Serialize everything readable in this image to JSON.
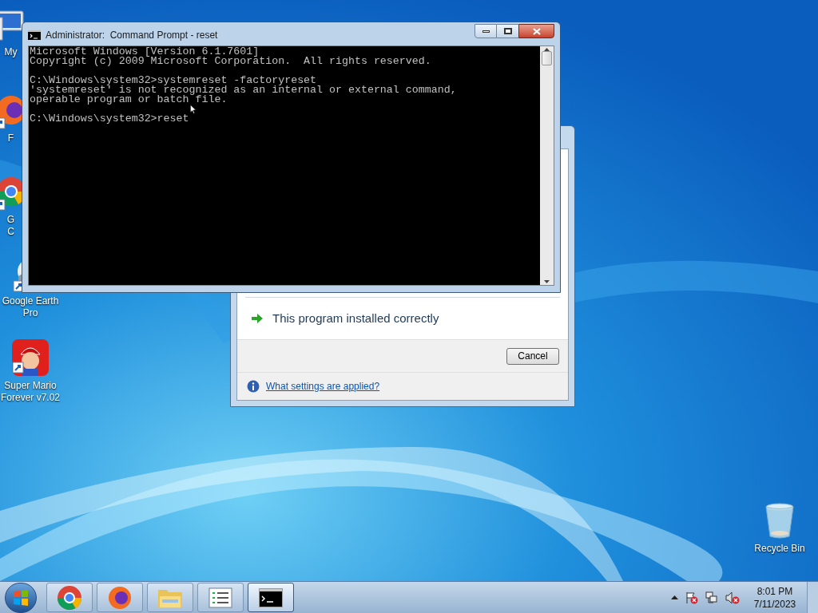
{
  "desktop_icons": [
    {
      "kind": "computer",
      "lines": [
        "My"
      ]
    },
    {
      "kind": "fox",
      "lines": [
        "F"
      ]
    },
    {
      "kind": "wheel",
      "lines": [
        "G",
        "C"
      ]
    },
    {
      "kind": "earth",
      "lines": [
        "Google Earth",
        "Pro"
      ]
    },
    {
      "kind": "game",
      "lines": [
        "Super Mario",
        "Forever v7.02"
      ]
    },
    {
      "kind": "bin",
      "lines": [
        "Recycle Bin"
      ]
    }
  ],
  "console_window": {
    "title": "Administrator:  Command Prompt - reset",
    "blocks": [
      [
        "Microsoft Windows [Version 6.1.7601]",
        "Copyright (c) 2009 Microsoft Corporation.  All rights reserved."
      ],
      [
        "C:\\Windows\\system32>systemreset -factoryreset",
        "'systemreset' is not recognized as an internal or external command,",
        "operable program or batch file."
      ],
      [
        "C:\\Windows\\system32>reset"
      ]
    ]
  },
  "dialog": {
    "message": "This program installed correctly",
    "button": "Cancel",
    "link": "What settings are applied?"
  },
  "taskbar": {
    "buttons": [
      {
        "kind": "wheel",
        "selected": false
      },
      {
        "kind": "fox",
        "selected": false
      },
      {
        "kind": "folder",
        "selected": false
      },
      {
        "kind": "list",
        "selected": false
      },
      {
        "kind": "terminal",
        "selected": true
      }
    ],
    "time": "8:01 PM",
    "date": "7/11/2023"
  }
}
